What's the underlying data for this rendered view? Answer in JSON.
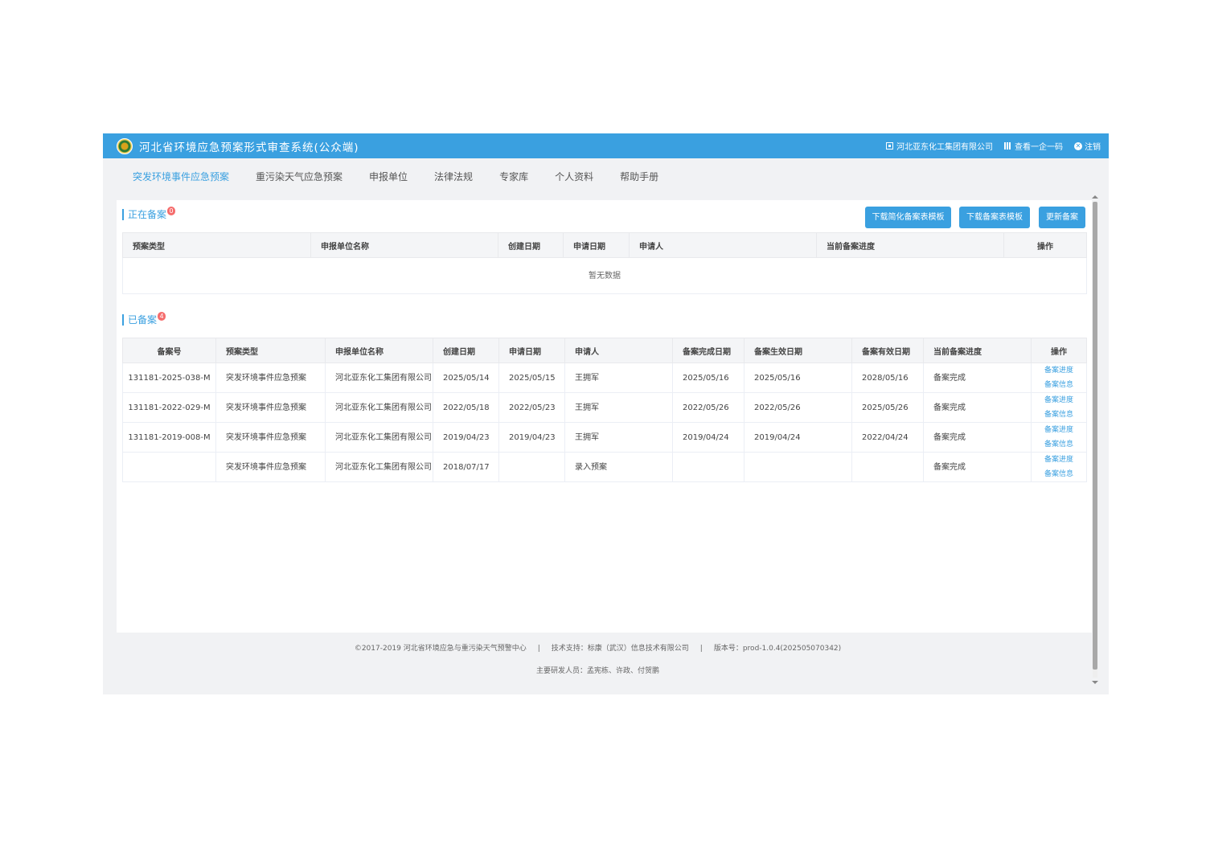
{
  "header": {
    "title": "河北省环境应急预案形式审查系统(公众端)",
    "company": "河北亚东化工集团有限公司",
    "view_code": "查看一企一码",
    "logout": "注销"
  },
  "nav": [
    {
      "label": "突发环境事件应急预案",
      "active": true
    },
    {
      "label": "重污染天气应急预案"
    },
    {
      "label": "申报单位"
    },
    {
      "label": "法律法规"
    },
    {
      "label": "专家库"
    },
    {
      "label": "个人资料"
    },
    {
      "label": "帮助手册"
    }
  ],
  "filing": {
    "title": "正在备案",
    "badge": "0",
    "buttons": {
      "download_simplified": "下载简化备案表模板",
      "download_template": "下载备案表模板",
      "update": "更新备案"
    },
    "columns": [
      "预案类型",
      "申报单位名称",
      "创建日期",
      "申请日期",
      "申请人",
      "当前备案进度",
      "操作"
    ],
    "empty": "暂无数据"
  },
  "filed": {
    "title": "已备案",
    "badge": "4",
    "columns": [
      "备案号",
      "预案类型",
      "申报单位名称",
      "创建日期",
      "申请日期",
      "申请人",
      "备案完成日期",
      "备案生效日期",
      "备案有效日期",
      "当前备案进度",
      "操作"
    ],
    "rows": [
      {
        "no": "131181-2025-038-M",
        "type": "突发环境事件应急预案",
        "unit": "河北亚东化工集团有限公司",
        "created": "2025/05/14",
        "applied": "2025/05/15",
        "applicant": "王拥军",
        "completed": "2025/05/16",
        "effective": "2025/05/16",
        "valid": "2028/05/16",
        "progress": "备案完成",
        "op1": "备案进度",
        "op2": "备案信息"
      },
      {
        "no": "131181-2022-029-M",
        "type": "突发环境事件应急预案",
        "unit": "河北亚东化工集团有限公司",
        "created": "2022/05/18",
        "applied": "2022/05/23",
        "applicant": "王拥军",
        "completed": "2022/05/26",
        "effective": "2022/05/26",
        "valid": "2025/05/26",
        "progress": "备案完成",
        "op1": "备案进度",
        "op2": "备案信息"
      },
      {
        "no": "131181-2019-008-M",
        "type": "突发环境事件应急预案",
        "unit": "河北亚东化工集团有限公司",
        "created": "2019/04/23",
        "applied": "2019/04/23",
        "applicant": "王拥军",
        "completed": "2019/04/24",
        "effective": "2019/04/24",
        "valid": "2022/04/24",
        "progress": "备案完成",
        "op1": "备案进度",
        "op2": "备案信息"
      },
      {
        "no": "",
        "type": "突发环境事件应急预案",
        "unit": "河北亚东化工集团有限公司",
        "created": "2018/07/17",
        "applied": "",
        "applicant": "录入预案",
        "completed": "",
        "effective": "",
        "valid": "",
        "progress": "备案完成",
        "op1": "备案进度",
        "op2": "备案信息"
      }
    ]
  },
  "footer": {
    "copyright": "©2017-2019 河北省环境应急与重污染天气预警中心",
    "support": "技术支持：标康（武汉）信息技术有限公司",
    "version": "版本号：prod-1.0.4(202505070342)",
    "developers": "主要研发人员：孟宪栋、许政、付贺鹏"
  }
}
